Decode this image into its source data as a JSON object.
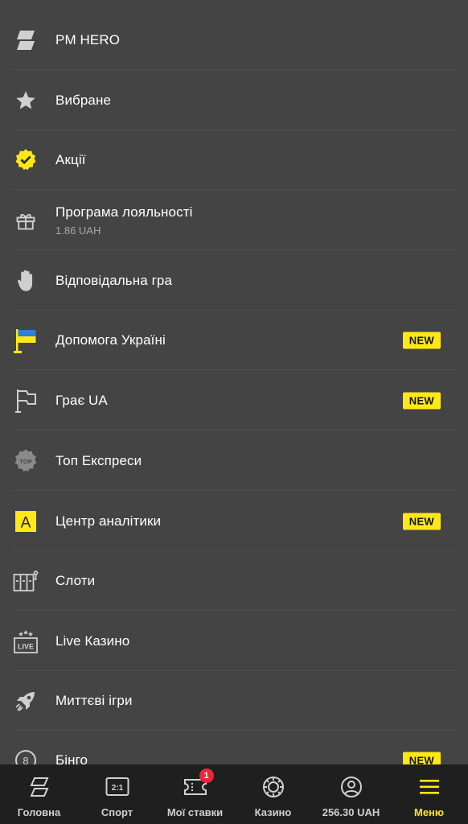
{
  "menu": {
    "items": [
      {
        "label": "PM HERO",
        "icon": "pm-hero-logo-icon"
      },
      {
        "label": "Вибране",
        "icon": "star-icon"
      },
      {
        "label": "Акції",
        "icon": "check-badge-icon"
      },
      {
        "label": "Програма лояльності",
        "sub": "1.86 UAH",
        "icon": "gift-icon"
      },
      {
        "label": "Відповідальна гра",
        "icon": "hand-icon"
      },
      {
        "label": "Допомога Україні",
        "icon": "ukraine-flag-icon",
        "badge": "NEW"
      },
      {
        "label": "Грає UA",
        "icon": "flag-icon",
        "badge": "NEW"
      },
      {
        "label": "Топ Експреси",
        "icon": "top-badge-icon"
      },
      {
        "label": "Центр аналітики",
        "icon": "analytics-a-icon",
        "badge": "NEW"
      },
      {
        "label": "Слоти",
        "icon": "slots-icon"
      },
      {
        "label": "Live Казино",
        "icon": "live-casino-icon"
      },
      {
        "label": "Миттєві ігри",
        "icon": "rocket-icon"
      },
      {
        "label": "Бінго",
        "icon": "bingo-ball-icon",
        "badge": "NEW"
      }
    ]
  },
  "bottom_nav": {
    "items": [
      {
        "label": "Головна",
        "icon": "home-logo-icon"
      },
      {
        "label": "Спорт",
        "icon": "scoreboard-icon",
        "icon_text": "2:1"
      },
      {
        "label": "Мої ставки",
        "icon": "ticket-icon",
        "count": "1"
      },
      {
        "label": "Казино",
        "icon": "casino-chip-icon"
      },
      {
        "label": "256.30 UAH",
        "icon": "profile-icon"
      },
      {
        "label": "Меню",
        "icon": "hamburger-icon"
      }
    ]
  },
  "colors": {
    "background": "#444444",
    "accent": "#ffe816",
    "nav_background": "#1f1f1f",
    "notification": "#e8283a"
  }
}
